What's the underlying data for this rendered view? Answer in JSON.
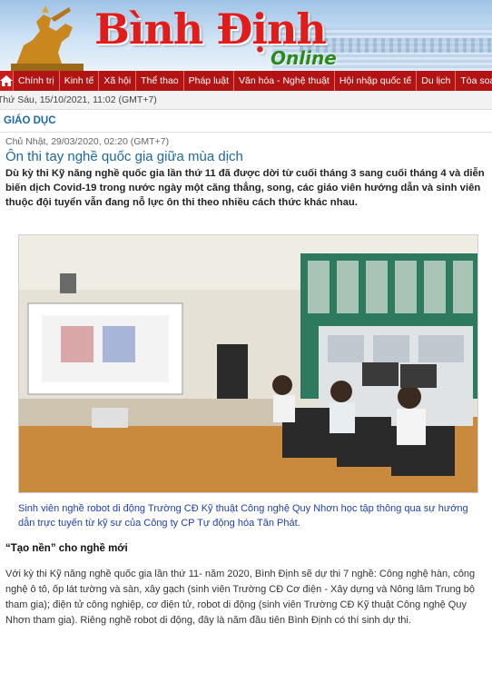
{
  "header": {
    "brand": "Bình Định",
    "brand_sub": "Online"
  },
  "nav": {
    "home_icon": "home-icon",
    "items": [
      "Chính trị",
      "Kinh tế",
      "Xã hội",
      "Thể thao",
      "Pháp luật",
      "Văn hóa - Nghệ thuật",
      "Hội nhập quốc tế",
      "Du lịch",
      "Tòa soạn - B"
    ]
  },
  "datebar": {
    "text": "Thứ Sáu, 15/10/2021, 11:02 (GMT+7)"
  },
  "colors": {
    "nav_bg": "#b21414",
    "link": "#1c6aa0",
    "caption": "#1e3fb0",
    "brand": "#e21b1b"
  },
  "article": {
    "section": "GIÁO DỤC",
    "date": "Chủ Nhật, 29/03/2020, 02:20 (GMT+7)",
    "title": "Ôn thi tay nghề quốc gia giữa mùa dịch",
    "lead": "Dù kỳ thi Kỹ năng nghề quốc gia lần thứ 11 đã được dời từ cuối tháng 3 sang cuối tháng 4 và diễn biến dịch Covid-19 trong nước ngày một căng thẳng, song, các giáo viên hướng dẫn và sinh viên thuộc đội tuyển vẫn đang nỗ lực ôn thi theo nhiều cách thức khác nhau.",
    "photo_caption": "Sinh viên nghề robot di động Trường CĐ Kỹ thuật Công nghệ Quy Nhơn học tập thông qua sự hướng dẫn trực tuyến từ kỹ sư của Công ty CP Tự động hóa Tân Phát.",
    "subhead": "“Tạo nền” cho nghề mới",
    "body": "Với kỳ thi Kỹ năng nghề quốc gia lần thứ 11- năm 2020, Bình Định sẽ dự thi 7 nghề: Công nghệ hàn, công nghệ ô tô, ốp lát tường và sàn, xây gạch (sinh viên Trường CĐ Cơ điện - Xây dựng và Nông lâm Trung bộ tham gia); điện tử công nghiệp, cơ điện tử, robot di động (sinh viên Trường CĐ Kỹ thuật Công nghệ Quy Nhơn tham gia). Riêng nghề robot di động, đây là năm đầu tiên Bình Định có thí sinh dự thi."
  }
}
